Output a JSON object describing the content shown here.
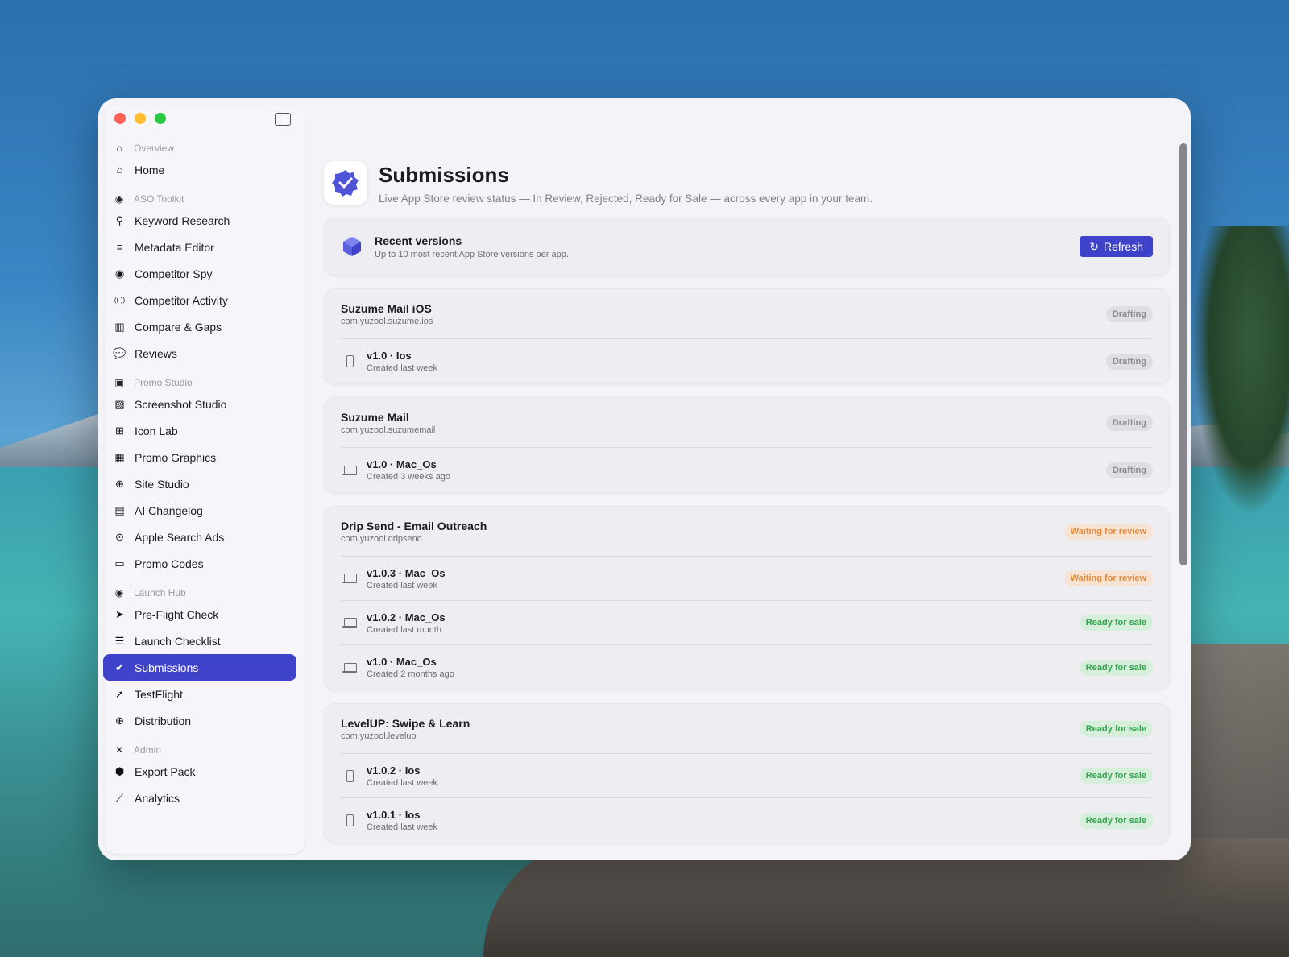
{
  "sidebar": {
    "sections": [
      {
        "title": "Overview",
        "icon": "house-icon",
        "items": [
          {
            "label": "Home",
            "icon": "house-icon"
          }
        ]
      },
      {
        "title": "ASO Toolkit",
        "icon": "aso-icon",
        "items": [
          {
            "label": "Keyword Research",
            "icon": "magnifier-icon"
          },
          {
            "label": "Metadata Editor",
            "icon": "text-lines-icon"
          },
          {
            "label": "Competitor Spy",
            "icon": "eye-icon"
          },
          {
            "label": "Competitor Activity",
            "icon": "broadcast-icon"
          },
          {
            "label": "Compare & Gaps",
            "icon": "columns-icon"
          },
          {
            "label": "Reviews",
            "icon": "chat-bubbles-icon"
          }
        ]
      },
      {
        "title": "Promo Studio",
        "icon": "bag-icon",
        "items": [
          {
            "label": "Screenshot Studio",
            "icon": "photo-icon"
          },
          {
            "label": "Icon Lab",
            "icon": "app-grid-icon"
          },
          {
            "label": "Promo Graphics",
            "icon": "graphics-icon"
          },
          {
            "label": "Site Studio",
            "icon": "globe-icon"
          },
          {
            "label": "AI Changelog",
            "icon": "document-icon"
          },
          {
            "label": "Apple Search Ads",
            "icon": "search-circle-icon"
          },
          {
            "label": "Promo Codes",
            "icon": "ticket-icon"
          }
        ]
      },
      {
        "title": "Launch Hub",
        "icon": "rocket-icon",
        "items": [
          {
            "label": "Pre-Flight Check",
            "icon": "plane-circle-icon"
          },
          {
            "label": "Launch Checklist",
            "icon": "checklist-icon"
          },
          {
            "label": "Submissions",
            "icon": "checkmark-seal-icon",
            "active": true
          },
          {
            "label": "TestFlight",
            "icon": "paperplane-circle-icon"
          },
          {
            "label": "Distribution",
            "icon": "globe-dark-icon"
          }
        ]
      },
      {
        "title": "Admin",
        "icon": "wrench-icon",
        "items": [
          {
            "label": "Export Pack",
            "icon": "box-icon"
          },
          {
            "label": "Analytics",
            "icon": "chart-line-icon"
          }
        ]
      }
    ]
  },
  "header": {
    "title": "Submissions",
    "subtitle": "Live App Store review status — In Review, Rejected, Ready for Sale — across every app in your team."
  },
  "recent": {
    "title": "Recent versions",
    "subtitle": "Up to 10 most recent App Store versions per app.",
    "refresh_label": "Refresh"
  },
  "colors": {
    "accent": "#3f43c9",
    "drafting": "#8a8a92",
    "waiting": "#e58a3a",
    "ready": "#2fa64a"
  },
  "apps": [
    {
      "name": "Suzume Mail iOS",
      "bundle": "com.yuzool.suzume.ios",
      "status": "Drafting",
      "status_kind": "drafting",
      "versions": [
        {
          "name": "v1.0 · Ios",
          "date": "Created last week",
          "status": "Drafting",
          "status_kind": "drafting",
          "device": "phone"
        }
      ]
    },
    {
      "name": "Suzume Mail",
      "bundle": "com.yuzool.suzumemail",
      "status": "Drafting",
      "status_kind": "drafting",
      "versions": [
        {
          "name": "v1.0 · Mac_Os",
          "date": "Created 3 weeks ago",
          "status": "Drafting",
          "status_kind": "drafting",
          "device": "laptop"
        }
      ]
    },
    {
      "name": "Drip Send - Email Outreach",
      "bundle": "com.yuzool.dripsend",
      "status": "Waiting for review",
      "status_kind": "waiting",
      "versions": [
        {
          "name": "v1.0.3 · Mac_Os",
          "date": "Created last week",
          "status": "Waiting for review",
          "status_kind": "waiting",
          "device": "laptop"
        },
        {
          "name": "v1.0.2 · Mac_Os",
          "date": "Created last month",
          "status": "Ready for sale",
          "status_kind": "ready",
          "device": "laptop"
        },
        {
          "name": "v1.0 · Mac_Os",
          "date": "Created 2 months ago",
          "status": "Ready for sale",
          "status_kind": "ready",
          "device": "laptop"
        }
      ]
    },
    {
      "name": "LevelUP: Swipe & Learn",
      "bundle": "com.yuzool.levelup",
      "status": "Ready for sale",
      "status_kind": "ready",
      "versions": [
        {
          "name": "v1.0.2 · Ios",
          "date": "Created last week",
          "status": "Ready for sale",
          "status_kind": "ready",
          "device": "phone"
        },
        {
          "name": "v1.0.1 · Ios",
          "date": "Created last week",
          "status": "Ready for sale",
          "status_kind": "ready",
          "device": "phone"
        }
      ]
    }
  ]
}
